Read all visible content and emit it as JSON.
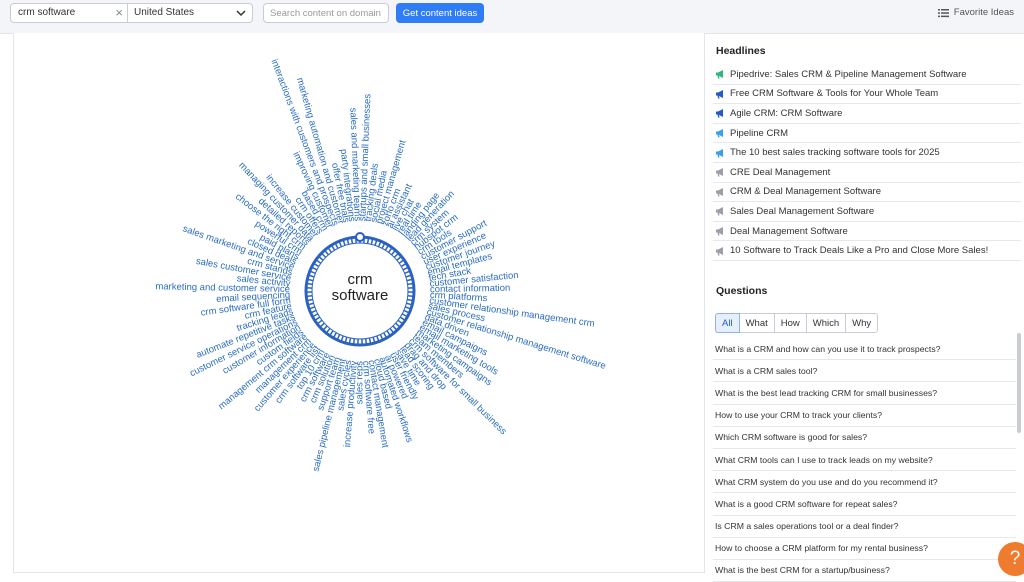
{
  "search": {
    "keyword": "crm software",
    "clear_icon": "close-icon",
    "country": "United States",
    "domain_placeholder": "Search content on domain",
    "get_ideas_label": "Get content ideas",
    "favorites_label": "Favorite Ideas",
    "favorites_icon": "list-icon"
  },
  "cloud": {
    "center_label_1": "crm",
    "center_label_2": "software",
    "ring_color": "#2a62c4",
    "text_color": "#2a6cc4",
    "topics": [
      "project management",
      "zoho crm",
      "ai assistant",
      "live chat",
      "real time",
      "landing page",
      "lead generation",
      "crm system",
      "hubspot crm",
      "crm tools",
      "customer support",
      "user experience",
      "customer journey",
      "email templates",
      "tech stack",
      "customer satisfaction",
      "contact information",
      "crm platforms",
      "customer relationship management crm",
      "sales process",
      "customer relationship management software",
      "data driven",
      "email campaigns",
      "email marketing tools",
      "marketing campaigns",
      "team members",
      "crm software for small business",
      "drag and drop",
      "lead scoring",
      "save time",
      "user friendly",
      "ai powered",
      "automated workflows",
      "cloud based",
      "contact management",
      "crm software free",
      "sales reps",
      "increase productivity",
      "sales cycles",
      "sales pipeline management",
      "support team",
      "crm solution",
      "crm software",
      "top 10 crm",
      "crm software list",
      "customer experience",
      "management crm",
      "management crm software",
      "custom fields",
      "customer information",
      "customer service operations",
      "automate repetitive tasks",
      "tracking leads",
      "crm feature",
      "crm software full form",
      "email sequencing",
      "marketing and customer service",
      "sales activity",
      "sales customer service",
      "crm stands",
      "sales marketing and service",
      "closed deals",
      "paid plans",
      "powerful crm",
      "choose the right crm",
      "detailed reports",
      "managing customer data",
      "increase customer",
      "crm offers",
      "based crm",
      "improving customer",
      "interactions with customers and prospects",
      "marketing automation and customer",
      "offer free trials",
      "party integrations",
      "sales and marketing teams",
      "startups and small businesses",
      "tracking deals",
      "social media"
    ]
  },
  "headlines": {
    "title": "Headlines",
    "items": [
      {
        "text": "Pipedrive: Sales CRM & Pipeline Management Software",
        "icon": "megaphone-icon",
        "color": "#2fb87a"
      },
      {
        "text": "Free CRM Software & Tools for Your Whole Team",
        "icon": "megaphone-icon",
        "color": "#2559c8"
      },
      {
        "text": "Agile CRM: CRM Software",
        "icon": "megaphone-icon",
        "color": "#2559c8"
      },
      {
        "text": "Pipeline CRM",
        "icon": "megaphone-icon",
        "color": "#3aa0e8"
      },
      {
        "text": "The 10 best sales tracking software tools for 2025",
        "icon": "megaphone-icon",
        "color": "#3aa0e8"
      },
      {
        "text": "CRE Deal Management",
        "icon": "megaphone-icon",
        "color": "#9aa0aa"
      },
      {
        "text": "CRM & Deal Management Software",
        "icon": "megaphone-icon",
        "color": "#9aa0aa"
      },
      {
        "text": "Sales Deal Management Software",
        "icon": "megaphone-icon",
        "color": "#9aa0aa"
      },
      {
        "text": "Deal Management Software",
        "icon": "megaphone-icon",
        "color": "#9aa0aa"
      },
      {
        "text": "10 Software to Track Deals Like a Pro and Close More Sales!",
        "icon": "megaphone-icon",
        "color": "#9aa0aa"
      }
    ]
  },
  "questions": {
    "title": "Questions",
    "tabs": [
      "All",
      "What",
      "How",
      "Which",
      "Why"
    ],
    "active_tab": "All",
    "items": [
      "What is a CRM and how can you use it to track prospects?",
      "What is a CRM sales tool?",
      "What is the best lead tracking CRM for small businesses?",
      "How to use your CRM to track your clients?",
      "Which CRM software is good for sales?",
      "What CRM tools can I use to track leads on my website?",
      "What CRM system do you use and do you recommend it?",
      "What is a good CRM software for repeat sales?",
      "Is CRM a sales operations tool or a deal finder?",
      "How to choose a CRM platform for my rental business?",
      "What is the best CRM for a startup/business?"
    ]
  },
  "help": {
    "label": "?",
    "icon": "help-icon"
  }
}
